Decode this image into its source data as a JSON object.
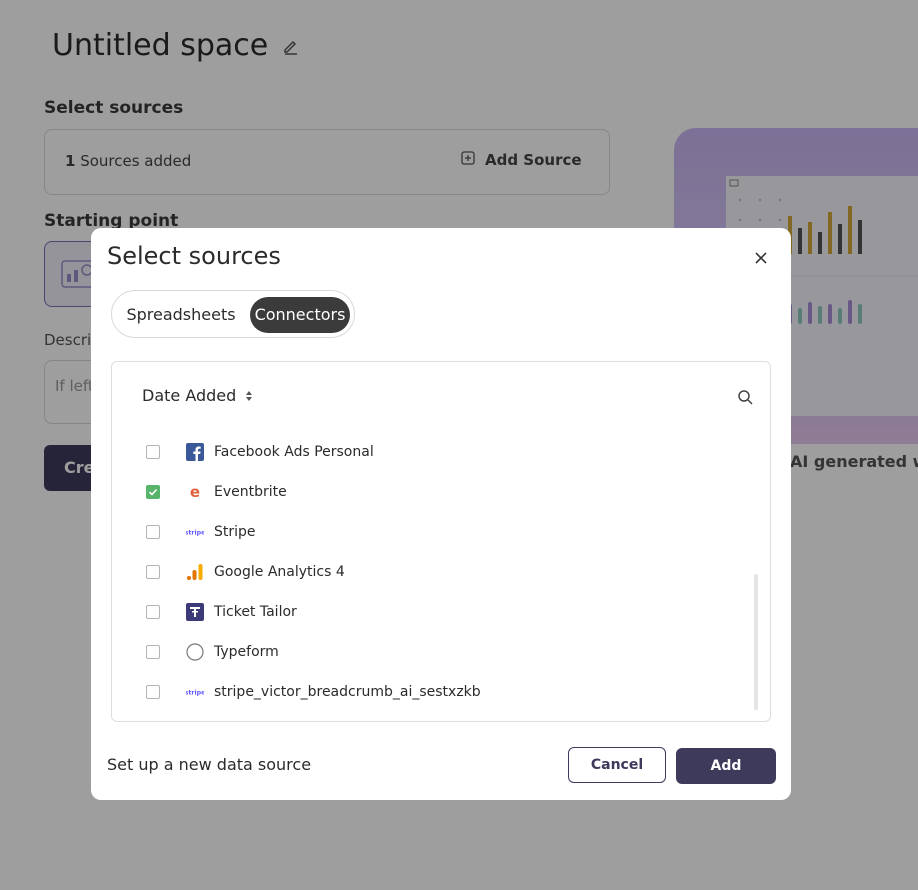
{
  "page": {
    "title": "Untitled space",
    "select_sources_label": "Select sources",
    "sources_count": "1",
    "sources_suffix": " Sources added",
    "add_source_label": "Add Source",
    "starting_point_label": "Starting point",
    "description_label": "Descri",
    "description_placeholder": "If left",
    "create_label": "Cre",
    "preview_caption": "AI generated widg"
  },
  "modal": {
    "title": "Select sources",
    "tabs": [
      {
        "label": "Spreadsheets",
        "active": false
      },
      {
        "label": "Connectors",
        "active": true
      }
    ],
    "sort_label": "Date Added",
    "sources": [
      {
        "label": "Facebook Ads Personal",
        "checked": false,
        "icon": "facebook-icon"
      },
      {
        "label": "Eventbrite",
        "checked": true,
        "icon": "eventbrite-icon"
      },
      {
        "label": "Stripe",
        "checked": false,
        "icon": "stripe-icon"
      },
      {
        "label": "Google Analytics 4",
        "checked": false,
        "icon": "google-analytics-icon"
      },
      {
        "label": "Ticket Tailor",
        "checked": false,
        "icon": "ticket-tailor-icon"
      },
      {
        "label": "Typeform",
        "checked": false,
        "icon": "typeform-icon"
      },
      {
        "label": "stripe_victor_breadcrumb_ai_sestxzkb",
        "checked": false,
        "icon": "stripe-icon"
      }
    ],
    "footer": {
      "setup_link": "Set up a new data source",
      "cancel_label": "Cancel",
      "add_label": "Add"
    }
  },
  "colors": {
    "primary": "#3d3a5c",
    "checked": "#58b46b",
    "tab_active": "#3b3b3b",
    "preview_bg": "#c8b6f2"
  }
}
